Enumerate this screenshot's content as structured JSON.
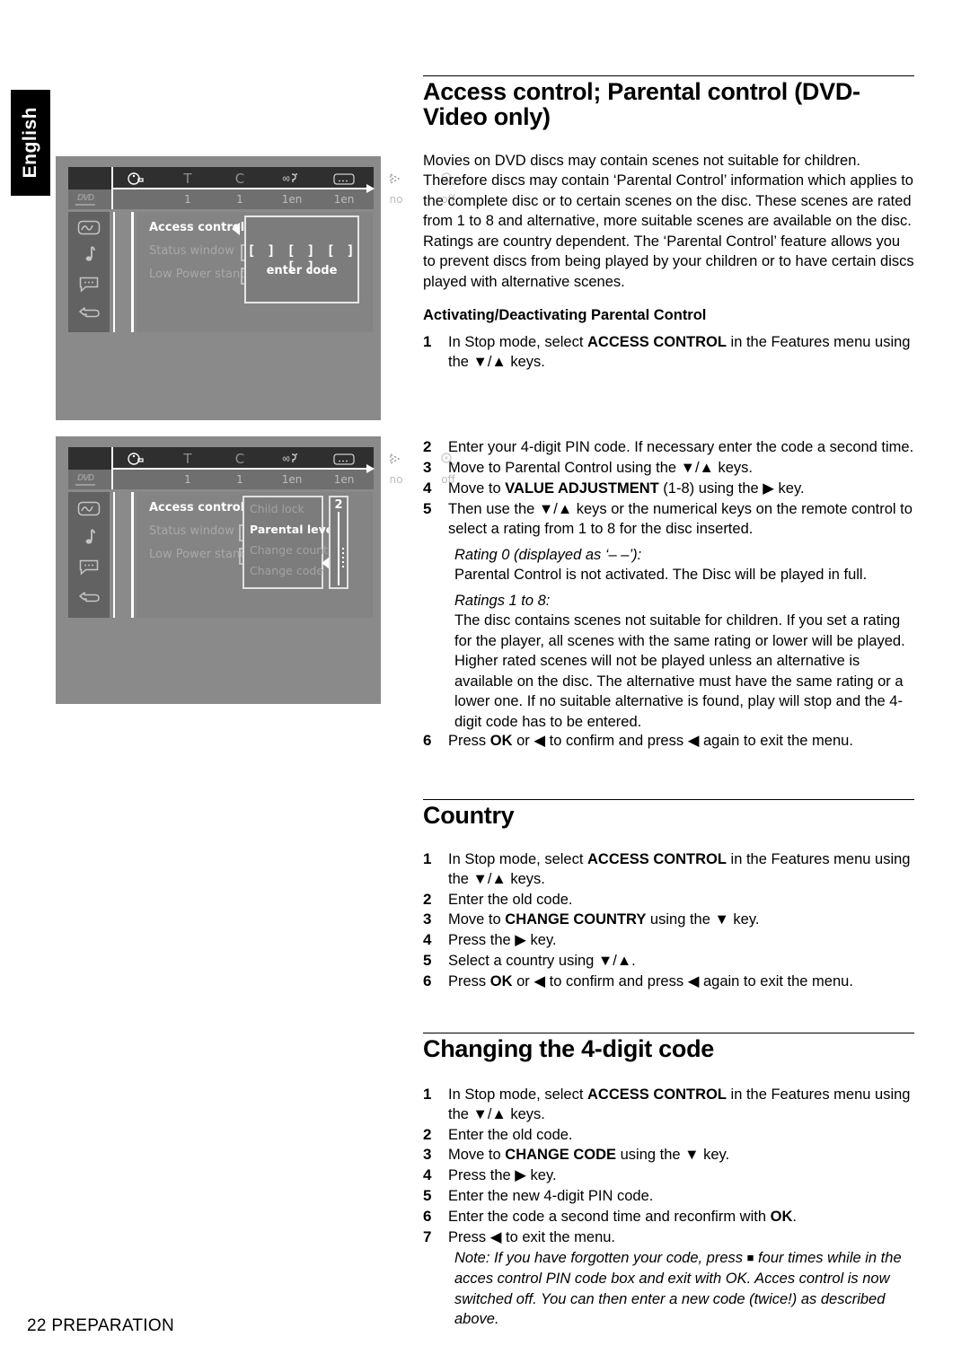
{
  "language_tab": "English",
  "footer": "22 PREPARATION",
  "osd": {
    "status_bar": {
      "disc_type": "DVD",
      "icons": [
        "disc-time-icon",
        "title-icon",
        "chapter-icon",
        "audio-language-icon",
        "subtitle-icon",
        "camera-angle-icon",
        "zoom-icon"
      ],
      "icon_labels": [
        "",
        "T",
        "C",
        "",
        "",
        "",
        ""
      ],
      "values": [
        "1",
        "1",
        "1en",
        "1en",
        "no",
        "off"
      ]
    },
    "sidebar_icons": [
      "picture-settings-icon",
      "sound-settings-icon",
      "language-settings-icon",
      "features-settings-icon"
    ],
    "menu_items": [
      "Access control",
      "Status window",
      "Low Power standby"
    ],
    "screen1": {
      "code_boxes": "[ ] [ ] [ ] [ ]",
      "code_label": "enter code"
    },
    "screen2": {
      "submenu": [
        "Child lock",
        "Parental level",
        "Change country",
        "Change code"
      ],
      "active_submenu": "Parental level",
      "value": "2"
    }
  },
  "sections": {
    "access_control": {
      "title": "Access control; Parental control (DVD-Video only)",
      "intro": "Movies on DVD discs may contain scenes not suitable for children. Therefore discs may contain ‘Parental Control’ information which applies to the complete disc or to certain scenes on the disc. These scenes are rated from 1 to 8 and alternative, more suitable scenes are available on the disc. Ratings are country dependent. The ‘Parental Control’ feature allows you to prevent discs from being played by your children or to have certain discs played with alternative scenes.",
      "subheading": "Activating/Deactivating Parental Control",
      "step1_a": "In Stop mode, select ",
      "step1_b": "ACCESS CONTROL",
      "step1_c": " in the Features menu using the ▼/▲ keys.",
      "step2": "Enter your 4-digit PIN code. If necessary enter the code a second time.",
      "step3": "Move to Parental Control using the ▼/▲  keys.",
      "step4_a": "Move to ",
      "step4_b": "VALUE ADJUSTMENT",
      "step4_c": " (1-8) using the ▶  key.",
      "step5": "Then use the ▼/▲ keys or the numerical keys on the remote control to select a rating from 1 to 8 for the disc inserted.",
      "rating0_head": "Rating 0 (displayed as ‘– –’):",
      "rating0_body": "Parental Control is not activated. The Disc will be played in full.",
      "ratings_head": "Ratings 1 to 8:",
      "ratings_body": "The disc contains scenes not suitable for children. If you set a rating for the player, all scenes with the same rating or lower will be played. Higher rated scenes will not be played unless an alternative is available on the disc. The alternative must have the same rating or a lower one. If no suitable alternative is found, play will stop and the 4-digit code has to be entered.",
      "step6_a": "Press ",
      "step6_b": "OK",
      "step6_c": " or ◀ to confirm and press ◀ again to exit the menu."
    },
    "country": {
      "title": "Country",
      "step1_a": "In Stop mode, select ",
      "step1_b": "ACCESS CONTROL",
      "step1_c": " in the Features menu using the ▼/▲  keys.",
      "step2": "Enter the old code.",
      "step3_a": "Move to ",
      "step3_b": "CHANGE COUNTRY",
      "step3_c": " using the ▼ key.",
      "step4": "Press the ▶ key.",
      "step5": "Select a country using ▼/▲.",
      "step6_a": "Press ",
      "step6_b": "OK",
      "step6_c": " or ◀ to confirm and press ◀ again to exit the menu."
    },
    "change_code": {
      "title": "Changing the 4-digit code",
      "step1_a": "In Stop mode, select ",
      "step1_b": "ACCESS CONTROL",
      "step1_c": " in the Features menu using the ▼/▲  keys.",
      "step2": "Enter the old code.",
      "step3_a": "Move to ",
      "step3_b": "CHANGE CODE",
      "step3_c": " using the ▼ key.",
      "step4": "Press the ▶ key.",
      "step5": "Enter the new 4-digit PIN code.",
      "step6_a": "Enter the code a second time and reconfirm with ",
      "step6_b": "OK",
      "step6_c": ".",
      "step7": "Press ◀ to exit the menu.",
      "note_a": "Note: If you have forgotten your code, press ",
      "note_b": " four times while in the acces control PIN code box and exit with OK. Acces control is now switched off. You can then enter a new code (twice!) as described above."
    }
  },
  "step_numbers": [
    "1",
    "2",
    "3",
    "4",
    "5",
    "6",
    "7"
  ]
}
